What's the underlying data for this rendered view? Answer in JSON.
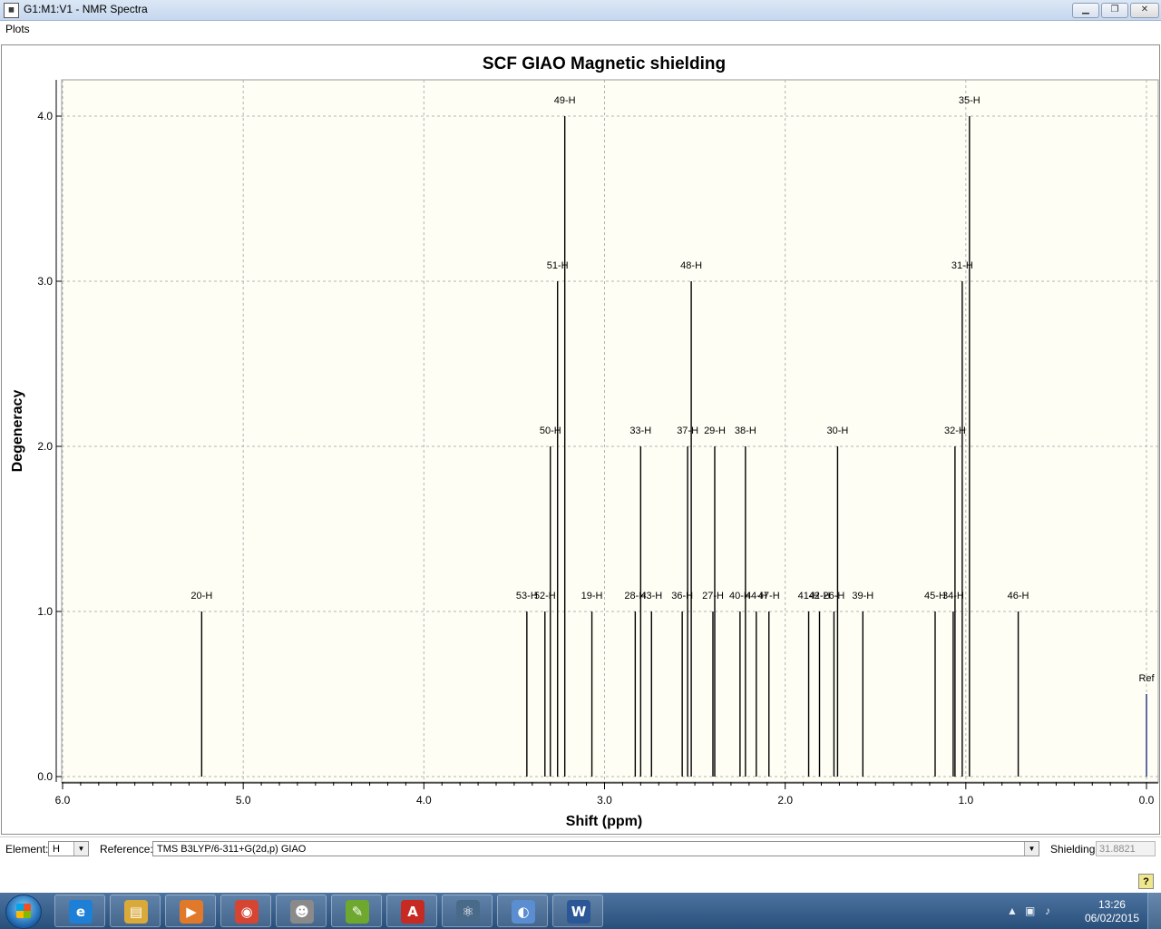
{
  "window": {
    "title": "G1:M1:V1 - NMR Spectra",
    "app_icon": "nmr-app-icon",
    "controls": {
      "minimize": "minimize-icon",
      "maximize": "maximize-icon",
      "close": "close-icon"
    }
  },
  "menu": {
    "items": [
      "Plots"
    ]
  },
  "chart_data": {
    "type": "bar",
    "title": "SCF GIAO Magnetic shielding",
    "xlabel": "Shift (ppm)",
    "ylabel": "Degeneracy",
    "xlim": [
      6.0,
      0.0
    ],
    "ylim": [
      0.0,
      4.2
    ],
    "x_reversed": true,
    "grid": true,
    "x_ticks": [
      "6.0",
      "5.0",
      "4.0",
      "3.0",
      "2.0",
      "1.0",
      "0.0"
    ],
    "y_ticks": [
      "0.0",
      "1.0",
      "2.0",
      "3.0",
      "4.0"
    ],
    "peaks": [
      {
        "label": "20-H",
        "x": 5.23,
        "y": 1
      },
      {
        "label": "53-H",
        "x": 3.43,
        "y": 1
      },
      {
        "label": "52-H",
        "x": 3.33,
        "y": 1
      },
      {
        "label": "50-H",
        "x": 3.3,
        "y": 2
      },
      {
        "label": "51-H",
        "x": 3.26,
        "y": 3
      },
      {
        "label": "49-H",
        "x": 3.22,
        "y": 4
      },
      {
        "label": "19-H",
        "x": 3.07,
        "y": 1
      },
      {
        "label": "28-H",
        "x": 2.83,
        "y": 1
      },
      {
        "label": "33-H",
        "x": 2.8,
        "y": 2
      },
      {
        "label": "43-H",
        "x": 2.74,
        "y": 1
      },
      {
        "label": "36-H",
        "x": 2.57,
        "y": 1
      },
      {
        "label": "37-H",
        "x": 2.54,
        "y": 2
      },
      {
        "label": "48-H",
        "x": 2.52,
        "y": 3
      },
      {
        "label": "27-H",
        "x": 2.4,
        "y": 1
      },
      {
        "label": "29-H",
        "x": 2.39,
        "y": 2
      },
      {
        "label": "40-H",
        "x": 2.25,
        "y": 1
      },
      {
        "label": "38-H",
        "x": 2.22,
        "y": 2
      },
      {
        "label": "44-H",
        "x": 2.16,
        "y": 1
      },
      {
        "label": "47-H",
        "x": 2.09,
        "y": 1
      },
      {
        "label": "41-H",
        "x": 1.87,
        "y": 1
      },
      {
        "label": "42-H",
        "x": 1.81,
        "y": 1
      },
      {
        "label": "26-H",
        "x": 1.73,
        "y": 1
      },
      {
        "label": "30-H",
        "x": 1.71,
        "y": 2
      },
      {
        "label": "39-H",
        "x": 1.57,
        "y": 1
      },
      {
        "label": "45-H",
        "x": 1.17,
        "y": 1
      },
      {
        "label": "34-H",
        "x": 1.07,
        "y": 1
      },
      {
        "label": "32-H",
        "x": 1.06,
        "y": 2
      },
      {
        "label": "31-H",
        "x": 1.02,
        "y": 3
      },
      {
        "label": "35-H",
        "x": 0.98,
        "y": 4
      },
      {
        "label": "46-H",
        "x": 0.71,
        "y": 1
      },
      {
        "label": "Ref",
        "x": 0.0,
        "y": 0.5,
        "color": "#1f2f7a"
      }
    ],
    "colors": {
      "plot_background": "#fffef5",
      "grid": "#b4b4b4",
      "peak": "#000000",
      "ref_peak": "#1f2f7a"
    }
  },
  "bottom": {
    "element_label": "Element:",
    "element_value": "H",
    "reference_label": "Reference:",
    "reference_value": "TMS B3LYP/6-311+G(2d,p) GIAO",
    "shielding_label": "Shielding:",
    "shielding_value": "31.8821",
    "help": "?"
  },
  "taskbar": {
    "apps": [
      {
        "name": "internet-explorer-icon",
        "glyph": "e",
        "color": "#1e7fd6"
      },
      {
        "name": "file-explorer-icon",
        "glyph": "▤",
        "color": "#d9a93a"
      },
      {
        "name": "media-player-icon",
        "glyph": "▶",
        "color": "#e07a2a"
      },
      {
        "name": "chrome-icon",
        "glyph": "◉",
        "color": "#d64532"
      },
      {
        "name": "mouse-app-icon",
        "glyph": "☻",
        "color": "#8a8a8a"
      },
      {
        "name": "chart-notepad-icon",
        "glyph": "✎",
        "color": "#6ea82e"
      },
      {
        "name": "acrobat-icon",
        "glyph": "A",
        "color": "#c62a22"
      },
      {
        "name": "molecule-viewer-icon",
        "glyph": "⚛",
        "color": "#4a6a8a"
      },
      {
        "name": "paint-icon",
        "glyph": "◐",
        "color": "#5a8ed0"
      },
      {
        "name": "word-icon",
        "glyph": "W",
        "color": "#2b5797"
      }
    ],
    "time": "13:26",
    "date": "06/02/2015"
  }
}
